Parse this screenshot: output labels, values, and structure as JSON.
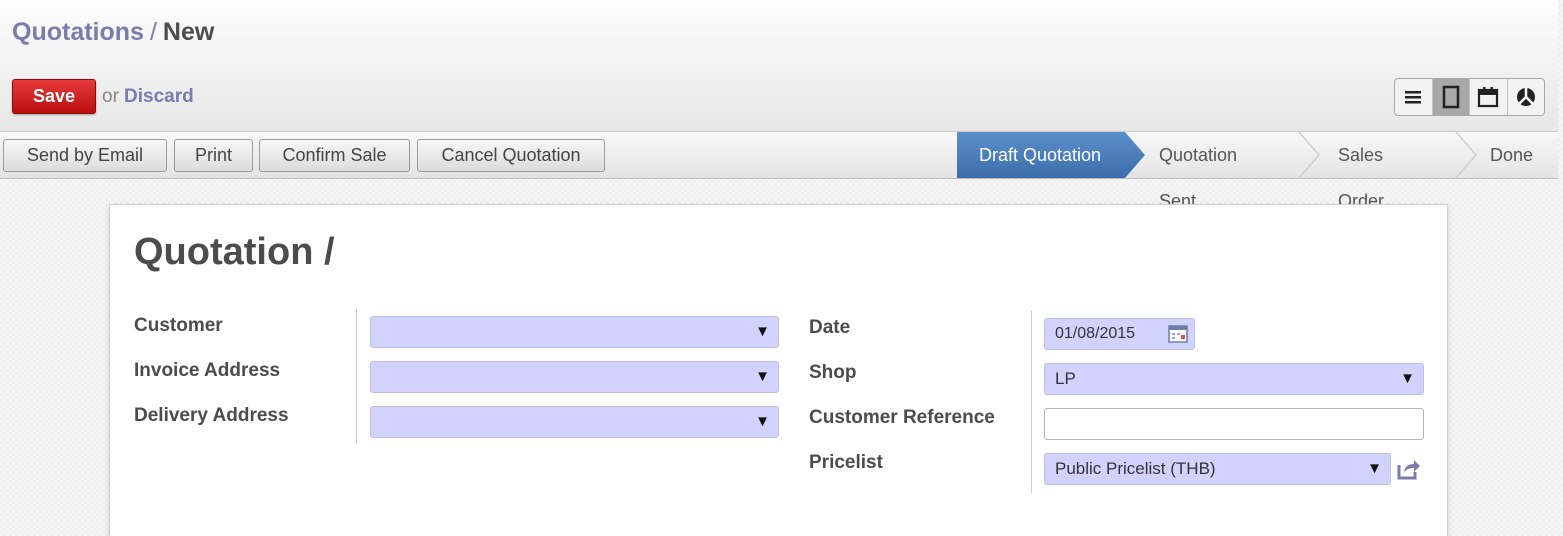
{
  "breadcrumb": {
    "parent": "Quotations",
    "separator": "/",
    "current": "New"
  },
  "actions": {
    "save": "Save",
    "or": "or",
    "discard": "Discard"
  },
  "view_switcher": [
    "list-view-icon",
    "form-view-icon",
    "calendar-view-icon",
    "graph-view-icon"
  ],
  "toolbar": {
    "buttons": [
      "Send by Email",
      "Print",
      "Confirm Sale",
      "Cancel Quotation"
    ]
  },
  "status": {
    "stages": [
      "Draft Quotation",
      "Quotation Sent",
      "Sales Order",
      "Done"
    ],
    "active": "Draft Quotation"
  },
  "form": {
    "title": "Quotation /",
    "left": {
      "customer": {
        "label": "Customer",
        "value": ""
      },
      "invoice_address": {
        "label": "Invoice Address",
        "value": ""
      },
      "delivery_address": {
        "label": "Delivery Address",
        "value": ""
      }
    },
    "right": {
      "date": {
        "label": "Date",
        "value": "01/08/2015"
      },
      "shop": {
        "label": "Shop",
        "value": "LP"
      },
      "customer_reference": {
        "label": "Customer Reference",
        "value": ""
      },
      "pricelist": {
        "label": "Pricelist",
        "value": "Public Pricelist (THB)"
      }
    },
    "dropdown_arrow": "▼"
  },
  "colors": {
    "accent_link": "#7c7bad",
    "save_button": "#d42323",
    "active_stage": "#4a7dba",
    "required_field": "#d2d2ff"
  }
}
